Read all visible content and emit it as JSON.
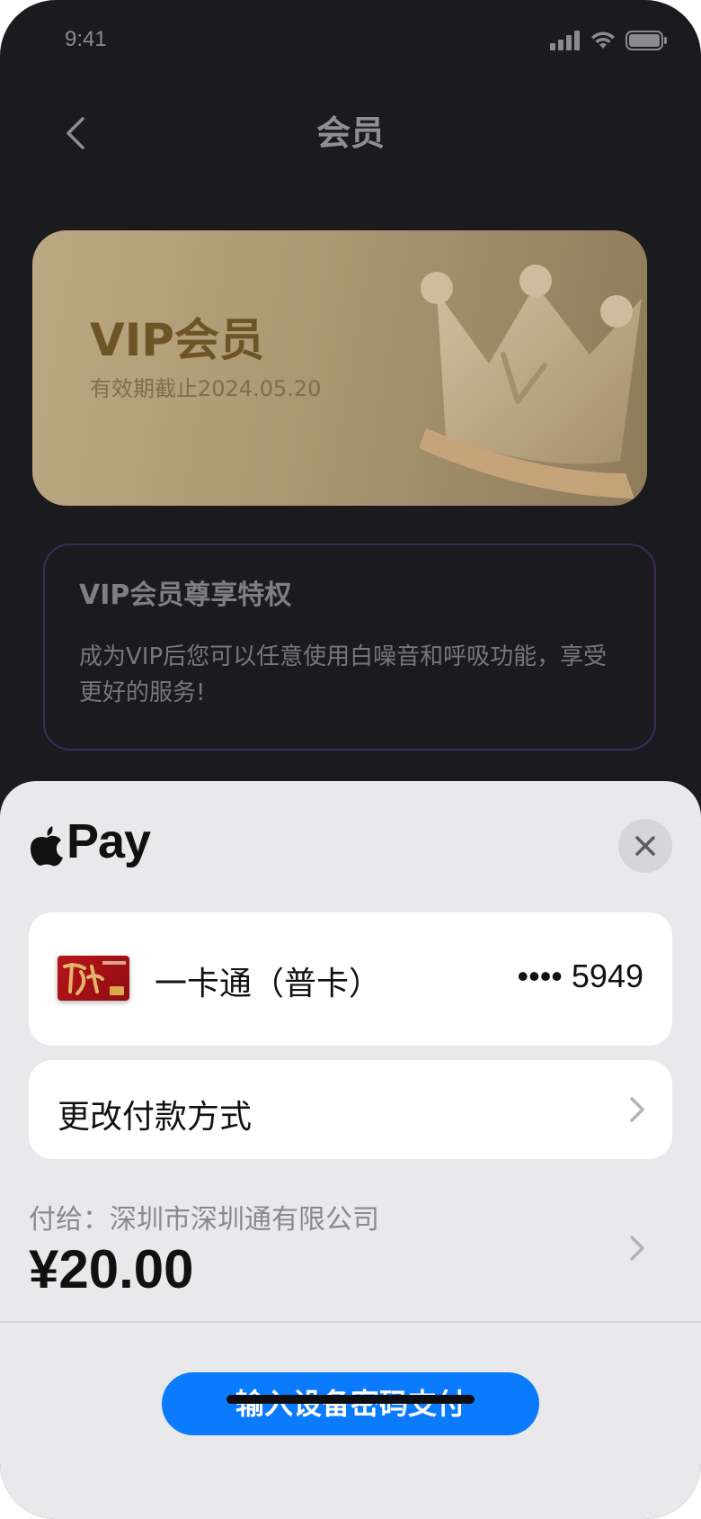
{
  "status_bar": {
    "time": "9:41"
  },
  "nav": {
    "title": "会员"
  },
  "vip_card": {
    "title": "VIP会员",
    "expiry": "有效期截止2024.05.20"
  },
  "privileges": {
    "title": "VIP会员尊享特权",
    "description": "成为VIP后您可以任意使用白噪音和呼吸功能，享受更好的服务!"
  },
  "apple_pay": {
    "brand": "Pay",
    "card": {
      "name": "一卡通（普卡）",
      "number": "•••• 5949"
    },
    "change_method_label": "更改付款方式",
    "payee": "付给：深圳市深圳通有限公司",
    "amount": "¥20.00",
    "pay_button_label": "输入设备密码支付"
  },
  "colors": {
    "background": "#1b1a1f",
    "vip_card": "#ab9772",
    "sheet": "#e9e9eb",
    "pay_button": "#0a7bff"
  },
  "icons": [
    "signal-icon",
    "wifi-icon",
    "battery-icon",
    "back-chevron-icon",
    "crown-icon",
    "apple-logo-icon",
    "close-icon",
    "bank-card-icon",
    "chevron-right-icon"
  ]
}
